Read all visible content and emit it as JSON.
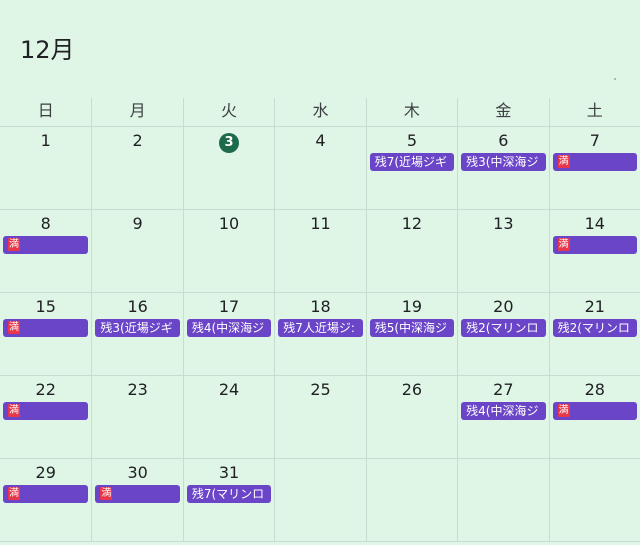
{
  "header": {
    "month": "12月"
  },
  "weekdays": [
    "日",
    "月",
    "火",
    "水",
    "木",
    "金",
    "土"
  ],
  "today": 3,
  "days": [
    {
      "day": "1",
      "event": null
    },
    {
      "day": "2",
      "event": null
    },
    {
      "day": "3",
      "event": null,
      "today": true
    },
    {
      "day": "4",
      "event": null
    },
    {
      "day": "5",
      "event": {
        "label": "残7(近場ジギ"
      }
    },
    {
      "day": "6",
      "event": {
        "label": "残3(中深海ジ"
      }
    },
    {
      "day": "7",
      "event": {
        "label": "満",
        "full": true
      }
    },
    {
      "day": "8",
      "event": {
        "label": "満",
        "full": true
      }
    },
    {
      "day": "9",
      "event": null
    },
    {
      "day": "10",
      "event": null
    },
    {
      "day": "11",
      "event": null
    },
    {
      "day": "12",
      "event": null
    },
    {
      "day": "13",
      "event": null
    },
    {
      "day": "14",
      "event": {
        "label": "満",
        "full": true
      }
    },
    {
      "day": "15",
      "event": {
        "label": "満",
        "full": true
      }
    },
    {
      "day": "16",
      "event": {
        "label": "残3(近場ジギ"
      }
    },
    {
      "day": "17",
      "event": {
        "label": "残4(中深海ジ"
      }
    },
    {
      "day": "18",
      "event": {
        "label": "残7人近場ジ:"
      }
    },
    {
      "day": "19",
      "event": {
        "label": "残5(中深海ジ"
      }
    },
    {
      "day": "20",
      "event": {
        "label": "残2(マリンロ"
      }
    },
    {
      "day": "21",
      "event": {
        "label": "残2(マリンロ"
      }
    },
    {
      "day": "22",
      "event": {
        "label": "満",
        "full": true
      }
    },
    {
      "day": "23",
      "event": null
    },
    {
      "day": "24",
      "event": null
    },
    {
      "day": "25",
      "event": null
    },
    {
      "day": "26",
      "event": null
    },
    {
      "day": "27",
      "event": {
        "label": "残4(中深海ジ"
      }
    },
    {
      "day": "28",
      "event": {
        "label": "満",
        "full": true
      }
    },
    {
      "day": "29",
      "event": {
        "label": "満",
        "full": true
      }
    },
    {
      "day": "30",
      "event": {
        "label": "満",
        "full": true
      }
    },
    {
      "day": "31",
      "event": {
        "label": "残7(マリンロ"
      }
    },
    {
      "day": "",
      "event": null
    },
    {
      "day": "",
      "event": null
    },
    {
      "day": "",
      "event": null
    },
    {
      "day": "",
      "event": null
    }
  ],
  "colors": {
    "background": "#dff5e6",
    "event": "#6a45c7",
    "full_badge": "#e8374a",
    "today": "#1e6b4b"
  }
}
